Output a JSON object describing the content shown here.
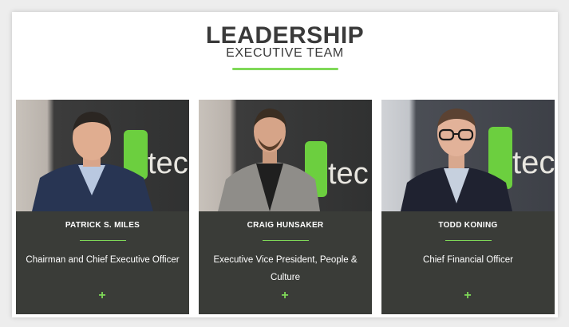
{
  "header": {
    "title": "LEADERSHIP",
    "subtitle": "EXECUTIVE TEAM"
  },
  "leaders": [
    {
      "name": "PATRICK S. MILES",
      "role": "Chairman and Chief Executive Officer",
      "expand_label": "+",
      "logo_text": "tec"
    },
    {
      "name": "CRAIG HUNSAKER",
      "role": "Executive Vice President, People & Culture",
      "expand_label": "+",
      "logo_text": "tec"
    },
    {
      "name": "TODD KONING",
      "role": "Chief Financial Officer",
      "expand_label": "+",
      "logo_text": "tec"
    }
  ],
  "colors": {
    "accent": "#7fd958",
    "card_bg": "#3a3c38",
    "title_text": "#3a3a3a"
  }
}
